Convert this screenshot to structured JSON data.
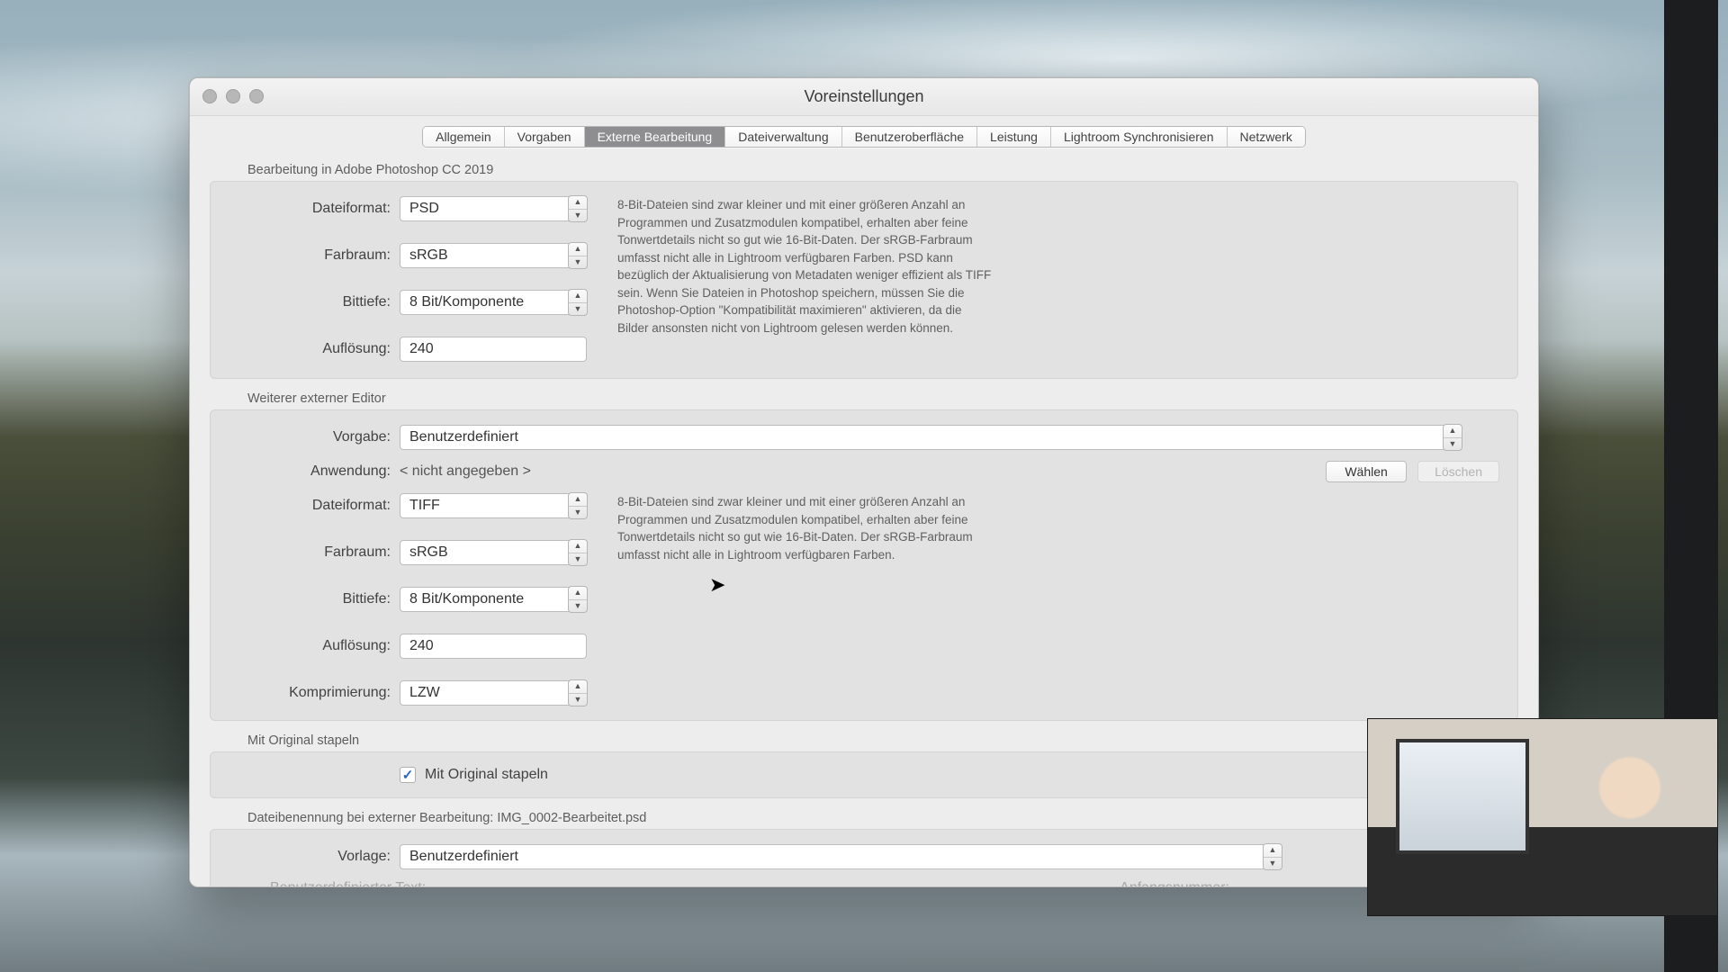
{
  "window": {
    "title": "Voreinstellungen"
  },
  "tabs": {
    "items": [
      "Allgemein",
      "Vorgaben",
      "Externe Bearbeitung",
      "Dateiverwaltung",
      "Benutzeroberfläche",
      "Leistung",
      "Lightroom Synchronisieren",
      "Netzwerk"
    ],
    "active_index": 2
  },
  "photoshop": {
    "section_title": "Bearbeitung in Adobe Photoshop CC 2019",
    "file_format_label": "Dateiformat:",
    "file_format_value": "PSD",
    "color_space_label": "Farbraum:",
    "color_space_value": "sRGB",
    "bit_depth_label": "Bittiefe:",
    "bit_depth_value": "8 Bit/Komponente",
    "resolution_label": "Auflösung:",
    "resolution_value": "240",
    "help_text": "8-Bit-Dateien sind zwar kleiner und mit einer größeren Anzahl an Programmen und Zusatzmodulen kompatibel, erhalten aber feine Tonwertdetails nicht so gut wie 16-Bit-Daten. Der sRGB-Farbraum umfasst nicht alle in Lightroom verfügbaren Farben. PSD kann bezüglich der Aktualisierung von Metadaten weniger effizient als TIFF sein. Wenn Sie Dateien in Photoshop speichern, müssen Sie die Photoshop-Option \"Kompatibilität maximieren\" aktivieren, da die Bilder ansonsten nicht von Lightroom gelesen werden können."
  },
  "external": {
    "section_title": "Weiterer externer Editor",
    "preset_label": "Vorgabe:",
    "preset_value": "Benutzerdefiniert",
    "application_label": "Anwendung:",
    "application_value": "< nicht angegeben >",
    "choose_label": "Wählen",
    "clear_label": "Löschen",
    "file_format_label": "Dateiformat:",
    "file_format_value": "TIFF",
    "color_space_label": "Farbraum:",
    "color_space_value": "sRGB",
    "bit_depth_label": "Bittiefe:",
    "bit_depth_value": "8 Bit/Komponente",
    "resolution_label": "Auflösung:",
    "resolution_value": "240",
    "compression_label": "Komprimierung:",
    "compression_value": "LZW",
    "help_text": "8-Bit-Dateien sind zwar kleiner und mit einer größeren Anzahl an Programmen und Zusatzmodulen kompatibel, erhalten aber feine Tonwertdetails nicht so gut wie 16-Bit-Daten. Der sRGB-Farbraum umfasst nicht alle in Lightroom verfügbaren Farben."
  },
  "stack": {
    "section_title": "Mit Original stapeln",
    "checkbox_label": "Mit Original stapeln",
    "checked": true
  },
  "naming": {
    "section_title": "Dateibenennung bei externer Bearbeitung: IMG_0002-Bearbeitet.psd",
    "template_label": "Vorlage:",
    "template_value": "Benutzerdefiniert",
    "custom_text_label": "Benutzerdefinierter Text:",
    "start_number_label": "Anfangsnummer:"
  }
}
